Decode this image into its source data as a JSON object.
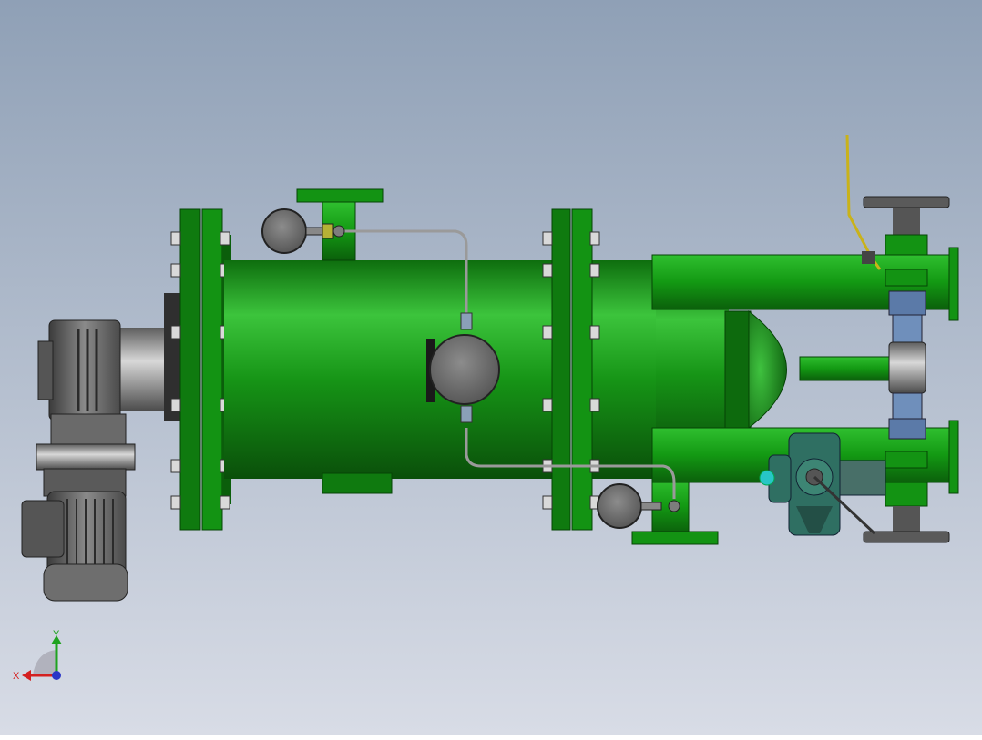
{
  "viewport": {
    "background_top": "#8fa0b6",
    "background_bottom": "#d8dce6"
  },
  "triad": {
    "x_label": "X",
    "y_label": "Y",
    "x_color": "#d42020",
    "y_color": "#1fa31f",
    "z_color": "#2a36c8"
  },
  "colors": {
    "vessel_green": "#1a9e1a",
    "flange_green": "#0f7a0f",
    "motor_gray": "#7a7a7a",
    "gauge_gray": "#6c6c6c",
    "pipe_gray": "#a0a0a0",
    "valve_teal": "#2f6f62",
    "accent_cyan": "#27c6c6",
    "lever_yellow": "#c9b21a"
  },
  "components": [
    "geared-motor",
    "filter-vessel",
    "flange-left",
    "flange-right",
    "top-nozzle",
    "bottom-nozzle",
    "pressure-gauge-top",
    "pressure-gauge-middle",
    "pressure-gauge-bottom",
    "inlet-pipe",
    "outlet-pipe",
    "butterfly-valve",
    "ball-valve-vertical"
  ]
}
